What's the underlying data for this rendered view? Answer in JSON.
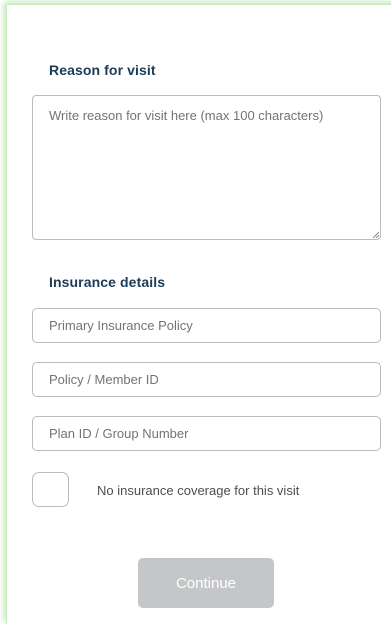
{
  "reason": {
    "title": "Reason for visit",
    "placeholder": "Write reason for visit here (max 100 characters)"
  },
  "insurance": {
    "title": "Insurance details",
    "primary_placeholder": "Primary Insurance Policy",
    "member_placeholder": "Policy / Member ID",
    "plan_placeholder": "Plan ID / Group Number",
    "no_coverage_label": "No insurance coverage for this visit"
  },
  "actions": {
    "continue_label": "Continue"
  },
  "colors": {
    "heading": "#1b3b57",
    "card_glow": "#8cd278",
    "button_disabled": "#c4c6c8"
  }
}
